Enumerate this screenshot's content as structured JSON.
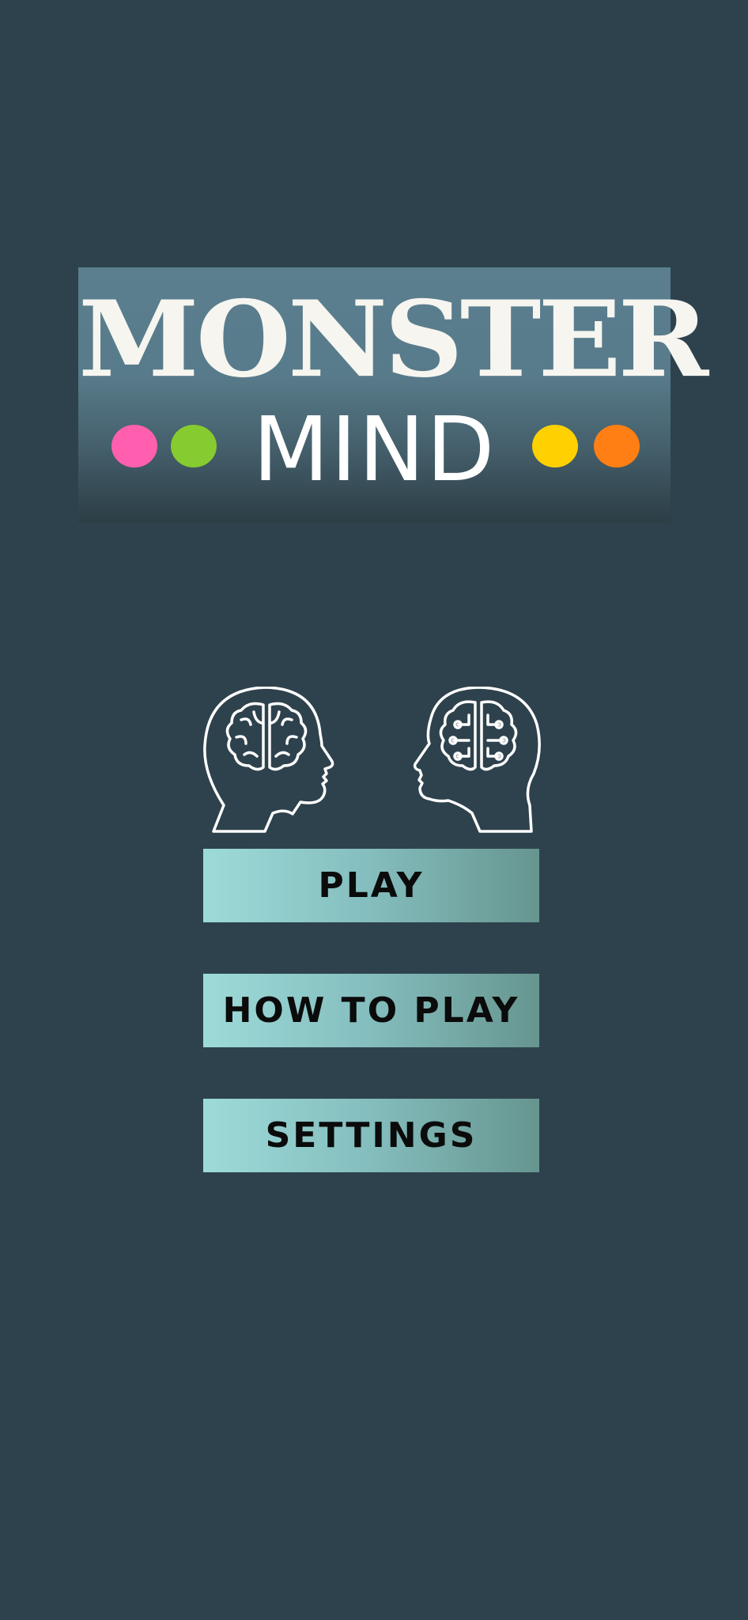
{
  "logo": {
    "title": "MONSTER",
    "subtitle": "MIND",
    "dot_colors": [
      "#ff5fae",
      "#86cb2f",
      "#ffd100",
      "#ff7f14"
    ]
  },
  "illustration": {
    "left_icon": "head-brain-icon",
    "right_icon": "head-circuit-brain-icon"
  },
  "menu": {
    "play_label": "PLAY",
    "how_to_play_label": "HOW TO PLAY",
    "settings_label": "SETTINGS"
  },
  "colors": {
    "background": "#2e424d",
    "button_gradient_start": "#9ddbd9",
    "button_gradient_end": "#66958f"
  }
}
